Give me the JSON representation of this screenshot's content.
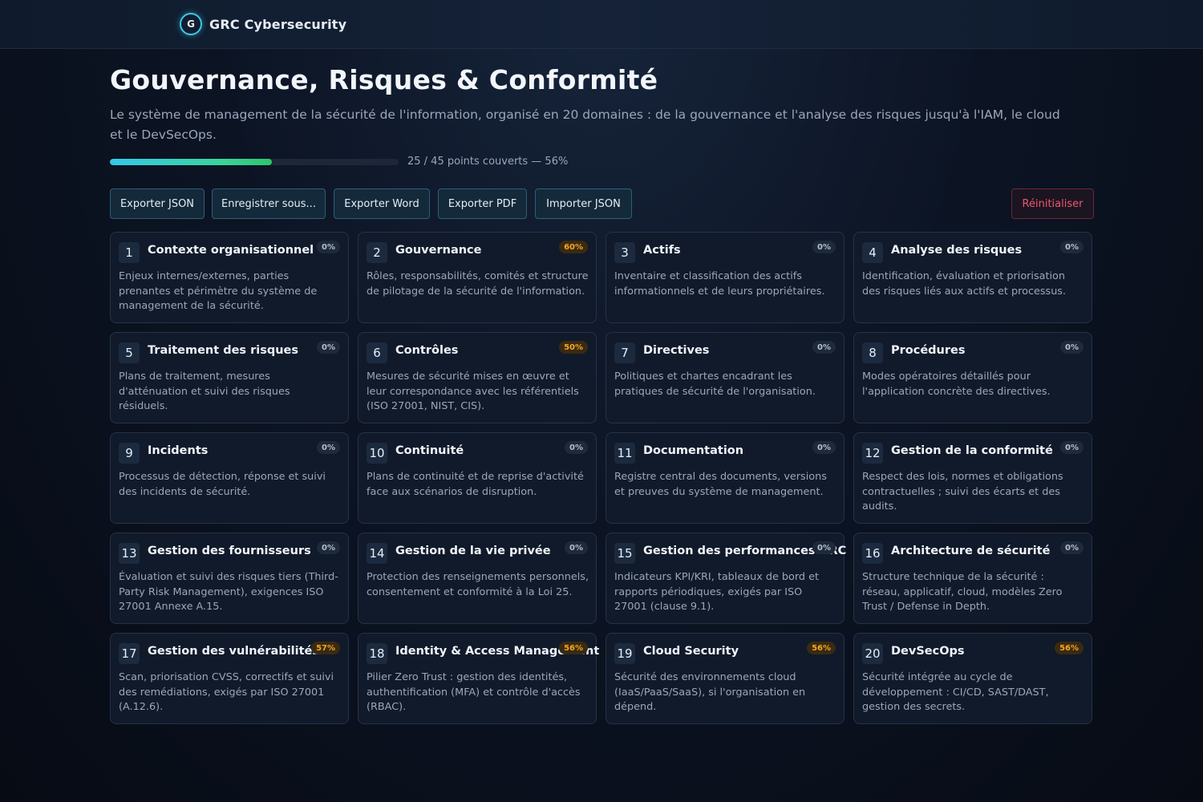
{
  "header": {
    "logo_letter": "G",
    "brand": "GRC Cybersecurity"
  },
  "main": {
    "title": "Gouvernance, Risques & Conformité",
    "subtitle": "Le système de management de la sécurité de l'information, organisé en 20 domaines : de la gouvernance et l'analyse des risques jusqu'à l'IAM, le cloud et le DevSecOps.",
    "progress": {
      "covered": 25,
      "total": 45,
      "percent": 56,
      "text": "25 / 45 points couverts — 56%"
    }
  },
  "toolbar": {
    "export_json": "Exporter JSON",
    "save_as": "Enregistrer sous...",
    "export_word": "Exporter Word",
    "export_pdf": "Exporter PDF",
    "import_json": "Importer JSON",
    "reset": "Réinitialiser"
  },
  "colors": {
    "accent": "#36c7ea",
    "progress_end": "#2ec56a",
    "badge_active": "#f5a623",
    "danger": "#f0566d"
  },
  "domains": [
    {
      "num": "1",
      "title": "Contexte organisationnel",
      "badge": "0%",
      "desc": "Enjeux internes/externes, parties prenantes et périmètre du système de management de la sécurité."
    },
    {
      "num": "2",
      "title": "Gouvernance",
      "badge": "60%",
      "desc": "Rôles, responsabilités, comités et structure de pilotage de la sécurité de l'information."
    },
    {
      "num": "3",
      "title": "Actifs",
      "badge": "0%",
      "desc": "Inventaire et classification des actifs informationnels et de leurs propriétaires."
    },
    {
      "num": "4",
      "title": "Analyse des risques",
      "badge": "0%",
      "desc": "Identification, évaluation et priorisation des risques liés aux actifs et processus."
    },
    {
      "num": "5",
      "title": "Traitement des risques",
      "badge": "0%",
      "desc": "Plans de traitement, mesures d'atténuation et suivi des risques résiduels."
    },
    {
      "num": "6",
      "title": "Contrôles",
      "badge": "50%",
      "desc": "Mesures de sécurité mises en œuvre et leur correspondance avec les référentiels (ISO 27001, NIST, CIS)."
    },
    {
      "num": "7",
      "title": "Directives",
      "badge": "0%",
      "desc": "Politiques et chartes encadrant les pratiques de sécurité de l'organisation."
    },
    {
      "num": "8",
      "title": "Procédures",
      "badge": "0%",
      "desc": "Modes opératoires détaillés pour l'application concrète des directives."
    },
    {
      "num": "9",
      "title": "Incidents",
      "badge": "0%",
      "desc": "Processus de détection, réponse et suivi des incidents de sécurité."
    },
    {
      "num": "10",
      "title": "Continuité",
      "badge": "0%",
      "desc": "Plans de continuité et de reprise d'activité face aux scénarios de disruption."
    },
    {
      "num": "11",
      "title": "Documentation",
      "badge": "0%",
      "desc": "Registre central des documents, versions et preuves du système de management."
    },
    {
      "num": "12",
      "title": "Gestion de la conformité",
      "badge": "0%",
      "desc": "Respect des lois, normes et obligations contractuelles ; suivi des écarts et des audits."
    },
    {
      "num": "13",
      "title": "Gestion des fournisseurs",
      "badge": "0%",
      "desc": "Évaluation et suivi des risques tiers (Third-Party Risk Management), exigences ISO 27001 Annexe A.15."
    },
    {
      "num": "14",
      "title": "Gestion de la vie privée",
      "badge": "0%",
      "desc": "Protection des renseignements personnels, consentement et conformité à la Loi 25."
    },
    {
      "num": "15",
      "title": "Gestion des performances GRC",
      "badge": "0%",
      "desc": "Indicateurs KPI/KRI, tableaux de bord et rapports périodiques, exigés par ISO 27001 (clause 9.1)."
    },
    {
      "num": "16",
      "title": "Architecture de sécurité",
      "badge": "0%",
      "desc": "Structure technique de la sécurité : réseau, applicatif, cloud, modèles Zero Trust / Defense in Depth."
    },
    {
      "num": "17",
      "title": "Gestion des vulnérabilités",
      "badge": "57%",
      "desc": "Scan, priorisation CVSS, correctifs et suivi des remédiations, exigés par ISO 27001 (A.12.6)."
    },
    {
      "num": "18",
      "title": "Identity & Access Management",
      "badge": "56%",
      "desc": "Pilier Zero Trust : gestion des identités, authentification (MFA) et contrôle d'accès (RBAC)."
    },
    {
      "num": "19",
      "title": "Cloud Security",
      "badge": "56%",
      "desc": "Sécurité des environnements cloud (IaaS/PaaS/SaaS), si l'organisation en dépend."
    },
    {
      "num": "20",
      "title": "DevSecOps",
      "badge": "56%",
      "desc": "Sécurité intégrée au cycle de développement : CI/CD, SAST/DAST, gestion des secrets."
    }
  ]
}
